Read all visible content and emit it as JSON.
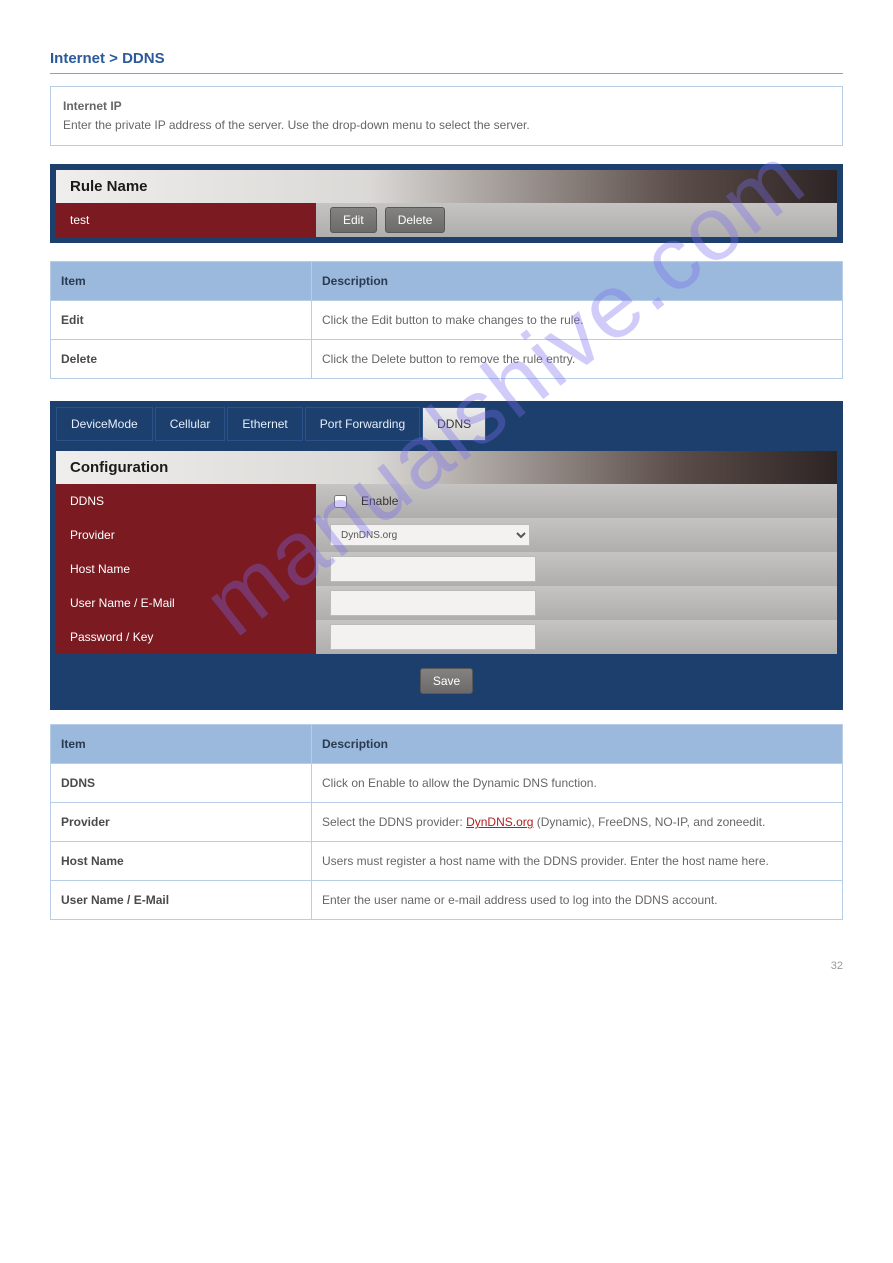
{
  "section": {
    "title": "Internet > DDNS",
    "intro_label": "Internet IP",
    "intro_text": "Enter the private IP address of the server. Use the drop-down menu to select the server."
  },
  "rule_panel": {
    "header": "Rule Name",
    "rule_value": "test",
    "edit": "Edit",
    "delete": "Delete"
  },
  "rule_table": {
    "col_item": "Item",
    "col_desc": "Description",
    "r1_item": "Edit",
    "r1_desc": "Click the Edit button to make changes to the rule.",
    "r2_item": "Delete",
    "r2_desc": "Click the Delete button to remove the rule entry."
  },
  "ddns": {
    "tabs": [
      "DeviceMode",
      "Cellular",
      "Ethernet",
      "Port Forwarding",
      "DDNS"
    ],
    "header": "Configuration",
    "row_ddns": "DDNS",
    "enable": "Enable",
    "row_provider": "Provider",
    "provider_value": "DynDNS.org",
    "row_host": "Host Name",
    "row_user": "User Name / E-Mail",
    "row_pass": "Password / Key",
    "save": "Save"
  },
  "ddns_table": {
    "col_item": "Item",
    "col_desc": "Description",
    "r1_item": "DDNS",
    "r1_desc": "Click on Enable to allow the Dynamic DNS function.",
    "r2_item": "Provider",
    "r2_desc_pre": "Select the DDNS provider: ",
    "r2_link": "DynDNS.org",
    "r2_desc_post": " (Dynamic), FreeDNS, NO-IP, and zoneedit.",
    "r3_item": "Host Name",
    "r3_desc": "Users must register a host name with the DDNS provider. Enter the host name here.",
    "r4_item": "User Name / E-Mail",
    "r4_desc": "Enter the user name or e-mail address used to log into the DDNS account."
  },
  "pagenum": "32",
  "watermark": "manualshive.com"
}
